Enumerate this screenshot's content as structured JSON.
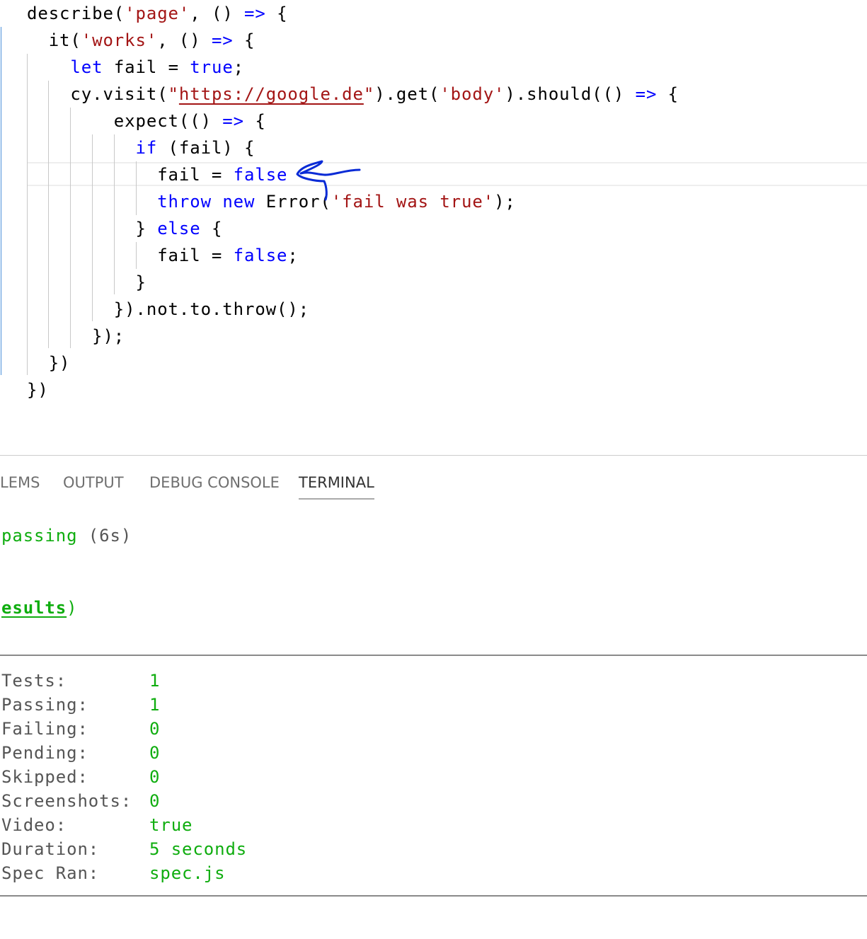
{
  "editor": {
    "lines": [
      [
        {
          "t": "plain",
          "v": "describe("
        },
        {
          "t": "str",
          "v": "'page'"
        },
        {
          "t": "plain",
          "v": ", () "
        },
        {
          "t": "kw",
          "v": "=>"
        },
        {
          "t": "plain",
          "v": " {"
        }
      ],
      [
        {
          "t": "plain",
          "v": "  it("
        },
        {
          "t": "str",
          "v": "'works'"
        },
        {
          "t": "plain",
          "v": ", () "
        },
        {
          "t": "kw",
          "v": "=>"
        },
        {
          "t": "plain",
          "v": " {"
        }
      ],
      [
        {
          "t": "plain",
          "v": "    "
        },
        {
          "t": "kw",
          "v": "let"
        },
        {
          "t": "plain",
          "v": " fail = "
        },
        {
          "t": "kw",
          "v": "true"
        },
        {
          "t": "plain",
          "v": ";"
        }
      ],
      [
        {
          "t": "plain",
          "v": "    cy.visit("
        },
        {
          "t": "str",
          "v": "\""
        },
        {
          "t": "url",
          "v": "https://google.de"
        },
        {
          "t": "str",
          "v": "\""
        },
        {
          "t": "plain",
          "v": ").get("
        },
        {
          "t": "str",
          "v": "'body'"
        },
        {
          "t": "plain",
          "v": ").should(() "
        },
        {
          "t": "kw",
          "v": "=>"
        },
        {
          "t": "plain",
          "v": " {"
        }
      ],
      [
        {
          "t": "plain",
          "v": "        expect(() "
        },
        {
          "t": "kw",
          "v": "=>"
        },
        {
          "t": "plain",
          "v": " {"
        }
      ],
      [
        {
          "t": "plain",
          "v": "          "
        },
        {
          "t": "kw",
          "v": "if"
        },
        {
          "t": "plain",
          "v": " (fail) {"
        }
      ],
      [
        {
          "t": "plain",
          "v": "            fail = "
        },
        {
          "t": "kw",
          "v": "false"
        }
      ],
      [
        {
          "t": "plain",
          "v": "            "
        },
        {
          "t": "kw",
          "v": "throw"
        },
        {
          "t": "plain",
          "v": " "
        },
        {
          "t": "kw",
          "v": "new"
        },
        {
          "t": "plain",
          "v": " Error("
        },
        {
          "t": "str",
          "v": "'fail was true'"
        },
        {
          "t": "plain",
          "v": ");"
        }
      ],
      [
        {
          "t": "plain",
          "v": "          } "
        },
        {
          "t": "kw",
          "v": "else"
        },
        {
          "t": "plain",
          "v": " {"
        }
      ],
      [
        {
          "t": "plain",
          "v": "            fail = "
        },
        {
          "t": "kw",
          "v": "false"
        },
        {
          "t": "plain",
          "v": ";"
        }
      ],
      [
        {
          "t": "plain",
          "v": "          }"
        }
      ],
      [
        {
          "t": "plain",
          "v": "        }).not.to.throw();"
        }
      ],
      [
        {
          "t": "plain",
          "v": "      });"
        }
      ],
      [
        {
          "t": "plain",
          "v": "  })"
        }
      ],
      [
        {
          "t": "plain",
          "v": "})"
        }
      ]
    ],
    "colors": {
      "keyword": "#0000ff",
      "string": "#a31515",
      "annotation": "#0a2bd6"
    }
  },
  "panel": {
    "tabs": [
      {
        "label": "LEMS",
        "active": false
      },
      {
        "label": "OUTPUT",
        "active": false
      },
      {
        "label": "DEBUG CONSOLE",
        "active": false
      },
      {
        "label": "TERMINAL",
        "active": true
      }
    ]
  },
  "terminal": {
    "passing_word": "passing",
    "passing_time": " (6s)",
    "results_link": "esults",
    "results_close": ")",
    "stats": [
      {
        "label": "Tests:",
        "value": "1"
      },
      {
        "label": "Passing:",
        "value": "1"
      },
      {
        "label": "Failing:",
        "value": "0"
      },
      {
        "label": "Pending:",
        "value": "0"
      },
      {
        "label": "Skipped:",
        "value": "0"
      },
      {
        "label": "Screenshots:",
        "value": "0"
      },
      {
        "label": "Video:",
        "value": "true"
      },
      {
        "label": "Duration:",
        "value": "5 seconds"
      },
      {
        "label": "Spec Ran:",
        "value": "spec.js"
      }
    ],
    "colors": {
      "success": "#0fad0f",
      "label": "#555555"
    }
  }
}
